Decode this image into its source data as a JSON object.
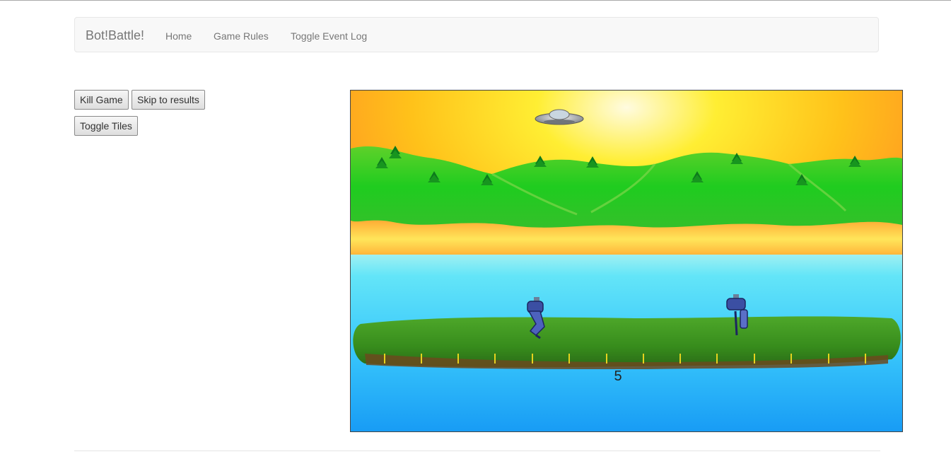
{
  "navbar": {
    "brand": "Bot!Battle!",
    "links": [
      "Home",
      "Game Rules",
      "Toggle Event Log"
    ]
  },
  "controls": {
    "kill_game": "Kill Game",
    "skip_results": "Skip to results",
    "toggle_tiles": "Toggle Tiles"
  },
  "game": {
    "tile_number": "5"
  }
}
